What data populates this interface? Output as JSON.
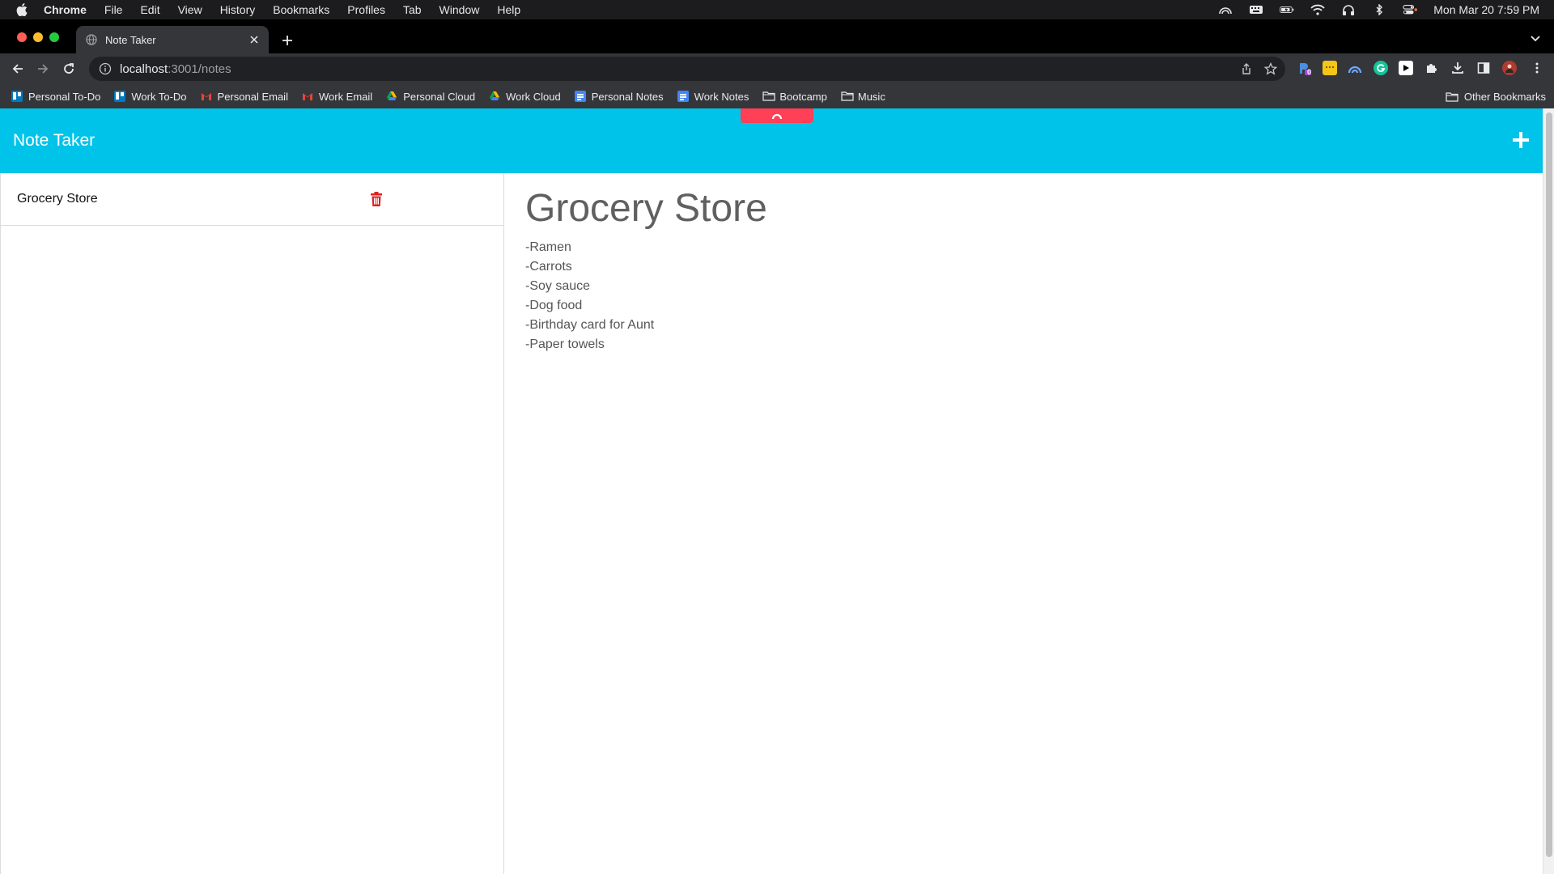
{
  "macos_menubar": {
    "app_name": "Chrome",
    "menus": [
      "File",
      "Edit",
      "View",
      "History",
      "Bookmarks",
      "Profiles",
      "Tab",
      "Window",
      "Help"
    ],
    "clock": "Mon Mar 20  7:59 PM"
  },
  "browser": {
    "tab": {
      "title": "Note Taker"
    },
    "address": {
      "host": "localhost",
      "rest": ":3001/notes"
    },
    "extensions": [
      "extension-1-icon",
      "extension-2-icon",
      "extension-3-icon",
      "grammarly-icon",
      "play-icon",
      "puzzle-icon"
    ],
    "extension_badge": "0"
  },
  "bookmarks": {
    "items": [
      {
        "label": "Personal To-Do",
        "icon": "trello-icon"
      },
      {
        "label": "Work To-Do",
        "icon": "trello-icon"
      },
      {
        "label": "Personal Email",
        "icon": "gmail-icon"
      },
      {
        "label": "Work Email",
        "icon": "gmail-icon"
      },
      {
        "label": "Personal Cloud",
        "icon": "drive-icon"
      },
      {
        "label": "Work Cloud",
        "icon": "drive-icon"
      },
      {
        "label": "Personal Notes",
        "icon": "docs-icon"
      },
      {
        "label": "Work Notes",
        "icon": "docs-icon"
      },
      {
        "label": "Bootcamp",
        "icon": "folder-icon"
      },
      {
        "label": "Music",
        "icon": "folder-icon"
      }
    ],
    "other": "Other Bookmarks"
  },
  "app": {
    "title": "Note Taker",
    "notes": [
      {
        "title": "Grocery Store"
      }
    ],
    "active_note": {
      "title": "Grocery Store",
      "lines": [
        "-Ramen",
        "-Carrots",
        "-Soy sauce",
        "-Dog food",
        "-Birthday card for Aunt",
        "-Paper towels"
      ]
    },
    "colors": {
      "header": "#00c3e9",
      "accent": "#ff4057",
      "delete": "#e02020"
    }
  }
}
